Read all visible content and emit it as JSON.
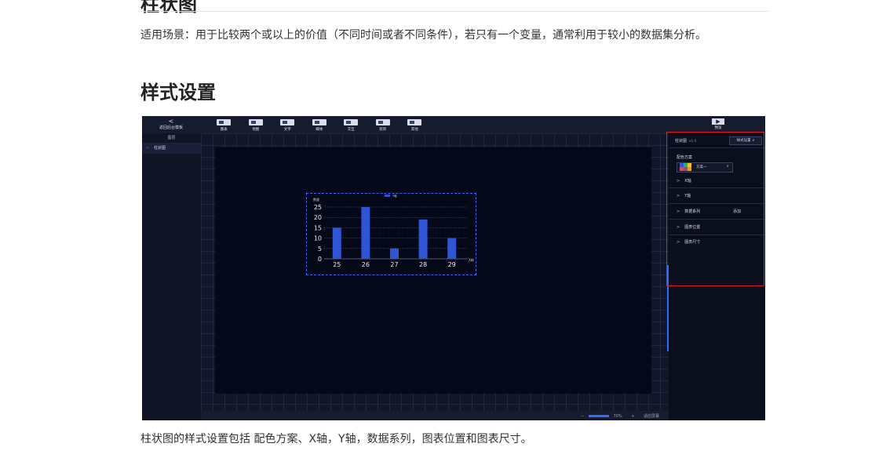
{
  "doc": {
    "top_heading": "柱状图",
    "para": "适用场景：用于比较两个或以上的价值（不同时间或者不同条件），若只有一个变量，通常利用于较小的数据集分析。",
    "heading2": "样式设置",
    "caption": "柱状图的样式设置包括 配色方案、X轴，Y轴，数据系列，图表位置和图表尺寸。"
  },
  "screenshot": {
    "back_label": "返回后台模板",
    "back_glyph": "<",
    "toolbar": [
      "图表",
      "地图",
      "文字",
      "媒体",
      "交互",
      "装饰",
      "其他"
    ],
    "preview_label": "预览",
    "preview_glyph": "▶",
    "left_panel": {
      "header": "图层",
      "item": "柱状图",
      "item_glyph": "‹›"
    },
    "bottom": {
      "zoom": "70%",
      "minus": "−",
      "plus": "+",
      "fit": "适应屏幕"
    },
    "right_panel": {
      "title": "柱状图",
      "version": "v1.0",
      "mode": "样式设置",
      "mode_glyph": "∨",
      "color_label": "配色方案",
      "scheme_name": "方案一",
      "scheme_colors": [
        "#2f55d4",
        "#27b36b",
        "#f4c430",
        "#e5484d",
        "#8e44ad",
        "#f39c12"
      ],
      "rows": [
        {
          "label": "X轴"
        },
        {
          "label": "Y轴"
        },
        {
          "label": "数据系列",
          "extra": "添加"
        },
        {
          "label": "图表位置"
        },
        {
          "label": "图表尺寸"
        }
      ],
      "row_arrow": ">"
    }
  },
  "chart_data": {
    "type": "bar",
    "categories": [
      "25",
      "26",
      "27",
      "28",
      "29"
    ],
    "values": [
      15,
      25,
      5,
      19,
      10
    ],
    "series": [
      {
        "name": "Y轴",
        "values": [
          15,
          25,
          5,
          19,
          10
        ]
      }
    ],
    "xlabel": "X轴",
    "ylabel": "数量",
    "ylim": [
      0,
      25
    ],
    "yticks": [
      0,
      5,
      10,
      15,
      20,
      25
    ],
    "bar_color": "#2f55d4",
    "grid": true,
    "legend": "top-center"
  }
}
